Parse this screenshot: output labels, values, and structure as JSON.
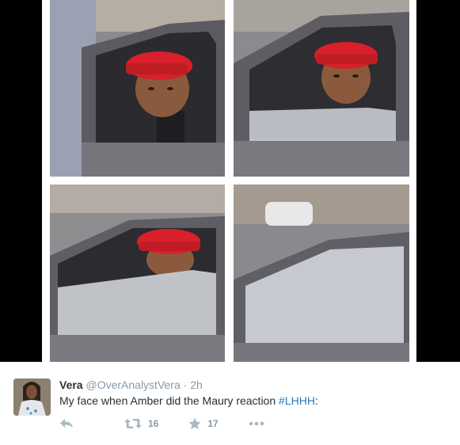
{
  "tweet": {
    "author": {
      "name": "Vera",
      "handle": "@OverAnalystVera",
      "separator": "·",
      "time": "2h"
    },
    "text": {
      "before": "My face when Amber did the Maury reaction ",
      "hashtag": "#LHHH",
      "after": ":"
    },
    "actions": {
      "reply_icon": "reply-icon",
      "retweet_icon": "retweet-icon",
      "retweet_count": "16",
      "favorite_icon": "star-icon",
      "favorite_count": "17",
      "more_icon": "more-dots-icon"
    }
  },
  "colors": {
    "name": "#292f33",
    "meta": "#8899a6",
    "hashtag": "#2b7bb9",
    "media_background": "#000000",
    "hat_red": "#d8202a"
  }
}
